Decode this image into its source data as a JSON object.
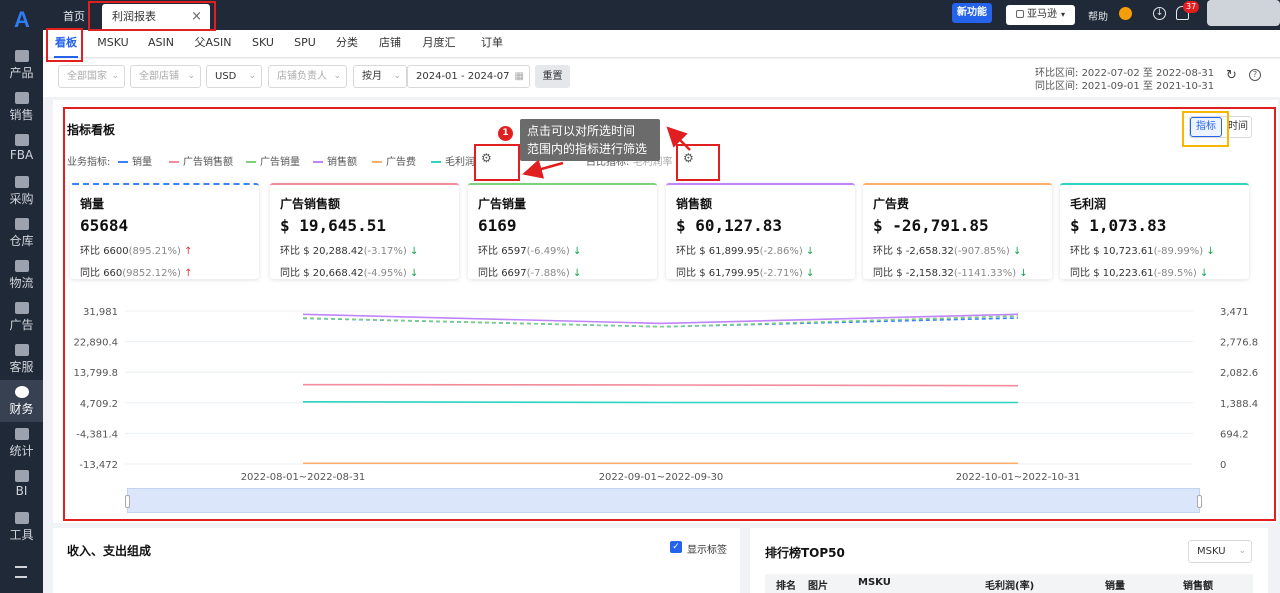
{
  "sidebar": {
    "logo": "A",
    "items": [
      {
        "label": "产品"
      },
      {
        "label": "销售"
      },
      {
        "label": "FBA"
      },
      {
        "label": "采购"
      },
      {
        "label": "仓库"
      },
      {
        "label": "物流"
      },
      {
        "label": "广告"
      },
      {
        "label": "客服"
      },
      {
        "label": "财务"
      },
      {
        "label": "统计"
      },
      {
        "label": "BI"
      },
      {
        "label": "工具"
      }
    ],
    "active": "财务"
  },
  "topbar": {
    "tabs": [
      {
        "label": "首页"
      },
      {
        "label": "利润报表"
      }
    ],
    "close_icon": "×",
    "new_feature": "新功能",
    "store_select": "亚马逊",
    "help": "帮助",
    "notification_count": "37"
  },
  "subnav": [
    "看板",
    "MSKU",
    "ASIN",
    "父ASIN",
    "SKU",
    "SPU",
    "分类",
    "店铺",
    "月度汇总",
    "订单"
  ],
  "filters": {
    "country": "全部国家",
    "store": "全部店铺",
    "currency": "USD",
    "owner": "店铺负责人",
    "period": "按月",
    "date_range": "2024-01  -  2024-07",
    "reset": "重置",
    "mom_label": "环比区间:",
    "mom_range": "2022-07-02 至 2022-08-31",
    "yoy_label": "同比区间:",
    "yoy_range": "2021-09-01 至 2021-10-31"
  },
  "dashboard": {
    "title": "指标看板",
    "business_metrics_label": "业务指标:",
    "ratio_metrics_label": "占比指标:",
    "ratio_metrics_value": "毛利润率",
    "toggle": {
      "metric": "指标",
      "time": "时间"
    },
    "callout": {
      "number": "1",
      "text_line1": "点击可以对所选时间",
      "text_line2": "范围内的指标进行筛选"
    },
    "legend": [
      {
        "name": "销量",
        "color": "#3b82f6"
      },
      {
        "name": "广告销售额",
        "color": "#f28b9b"
      },
      {
        "name": "广告销量",
        "color": "#7ed07e"
      },
      {
        "name": "销售额",
        "color": "#c084fc"
      },
      {
        "name": "广告费",
        "color": "#fdae6b"
      },
      {
        "name": "毛利润",
        "color": "#2dd4bf"
      }
    ],
    "kpis": [
      {
        "title": "销量",
        "value": "65684",
        "mom_label": "环比",
        "mom_value": "6600",
        "mom_pct": "(895.21%)",
        "mom_dir": "↑",
        "yoy_label": "同比",
        "yoy_value": "660",
        "yoy_pct": "(9852.12%)",
        "yoy_dir": "↑",
        "color": "#3b82f6"
      },
      {
        "title": "广告销售额",
        "value": "$ 19,645.51",
        "mom_label": "环比",
        "mom_value": "$ 20,288.42",
        "mom_pct": "(-3.17%)",
        "mom_dir": "↓",
        "yoy_label": "同比",
        "yoy_value": "$ 20,668.42",
        "yoy_pct": "(-4.95%)",
        "yoy_dir": "↓",
        "color": "#f28b9b"
      },
      {
        "title": "广告销量",
        "value": "6169",
        "mom_label": "环比",
        "mom_value": "6597",
        "mom_pct": "(-6.49%)",
        "mom_dir": "↓",
        "yoy_label": "同比",
        "yoy_value": "6697",
        "yoy_pct": "(-7.88%)",
        "yoy_dir": "↓",
        "color": "#7ed07e"
      },
      {
        "title": "销售额",
        "value": "$ 60,127.83",
        "mom_label": "环比",
        "mom_value": "$ 61,899.95",
        "mom_pct": "(-2.86%)",
        "mom_dir": "↓",
        "yoy_label": "同比",
        "yoy_value": "$ 61,799.95",
        "yoy_pct": "(-2.71%)",
        "yoy_dir": "↓",
        "color": "#c084fc"
      },
      {
        "title": "广告费",
        "value": "$ -26,791.85",
        "mom_label": "环比",
        "mom_value": "$ -2,658.32",
        "mom_pct": "(-907.85%)",
        "mom_dir": "↓",
        "yoy_label": "同比",
        "yoy_value": "$ -2,158.32",
        "yoy_pct": "(-1141.33%)",
        "yoy_dir": "↓",
        "color": "#fdae6b"
      },
      {
        "title": "毛利润",
        "value": "$ 1,073.83",
        "mom_label": "环比",
        "mom_value": "$ 10,723.61",
        "mom_pct": "(-89.99%)",
        "mom_dir": "↓",
        "yoy_label": "同比",
        "yoy_value": "$ 10,223.61",
        "yoy_pct": "(-89.5%)",
        "yoy_dir": "↓",
        "color": "#2dd4bf"
      }
    ]
  },
  "chart_data": {
    "type": "line",
    "categories": [
      "2022-08-01~2022-08-31",
      "2022-09-01~2022-09-30",
      "2022-10-01~2022-10-31"
    ],
    "y_left_ticks": [
      "31,981",
      "22,890.4",
      "13,799.8",
      "4,709.2",
      "-4,381.4",
      "-13,472"
    ],
    "y_right_ticks": [
      "3,471",
      "2,776.8",
      "2,082.6",
      "1,388.4",
      "694.2",
      "0"
    ],
    "ylim_left": [
      -13472,
      31981
    ],
    "ylim_right": [
      0,
      3471
    ],
    "series": [
      {
        "name": "销售额",
        "color": "#c084fc",
        "dashed": false,
        "axis": "left",
        "values": [
          31000,
          28300,
          31000
        ]
      },
      {
        "name": "销量",
        "color": "#3b82f6",
        "dashed": true,
        "axis": "left",
        "values": [
          29800,
          27300,
          29900
        ]
      },
      {
        "name": "广告销量",
        "color": "#7ed07e",
        "dashed": true,
        "axis": "left",
        "values": [
          29900,
          27300,
          30500
        ]
      },
      {
        "name": "广告销售额",
        "color": "#f28b9b",
        "dashed": false,
        "axis": "left",
        "values": [
          10100,
          10000,
          9800
        ]
      },
      {
        "name": "毛利润",
        "color": "#2dd4bf",
        "dashed": false,
        "axis": "left",
        "values": [
          5000,
          4800,
          4800
        ]
      },
      {
        "name": "广告费",
        "color": "#fdae6b",
        "dashed": false,
        "axis": "left",
        "values": [
          -13250,
          -13250,
          -13250
        ]
      }
    ]
  },
  "bottom_left": {
    "title": "收入、支出组成",
    "show_labels": "显示标签"
  },
  "bottom_right": {
    "title": "排行榜TOP50",
    "select": "MSKU",
    "columns": [
      "排名",
      "图片",
      "MSKU",
      "毛利润(率)",
      "销量",
      "销售额"
    ]
  }
}
